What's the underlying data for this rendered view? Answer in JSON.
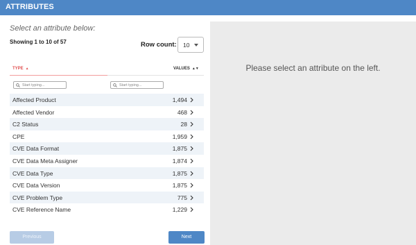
{
  "header": {
    "title": "ATTRIBUTES"
  },
  "left": {
    "subtitle": "Select an attribute below:",
    "showing": "Showing 1 to 10 of 57",
    "rowcount_label": "Row count:",
    "rowcount_value": "10",
    "columns": {
      "type": "TYPE",
      "values": "VALUES"
    },
    "filters": {
      "type_placeholder": "Start typing...",
      "values_placeholder": "Start typing..."
    },
    "rows": [
      {
        "label": "Affected Product",
        "value": "1,494"
      },
      {
        "label": "Affected Vendor",
        "value": "468"
      },
      {
        "label": "C2 Status",
        "value": "28"
      },
      {
        "label": "CPE",
        "value": "1,959"
      },
      {
        "label": "CVE Data Format",
        "value": "1,875"
      },
      {
        "label": "CVE Data Meta Assigner",
        "value": "1,874"
      },
      {
        "label": "CVE Data Type",
        "value": "1,875"
      },
      {
        "label": "CVE Data Version",
        "value": "1,875"
      },
      {
        "label": "CVE Problem Type",
        "value": "775"
      },
      {
        "label": "CVE Reference Name",
        "value": "1,229"
      }
    ],
    "pagination": {
      "previous": "Previous",
      "next": "Next"
    }
  },
  "right": {
    "message": "Please select an attribute on the left."
  },
  "colors": {
    "header": "#4e87c6",
    "accent_red": "#e05252",
    "row_alt": "#eef3f8",
    "panel": "#ebebeb"
  }
}
